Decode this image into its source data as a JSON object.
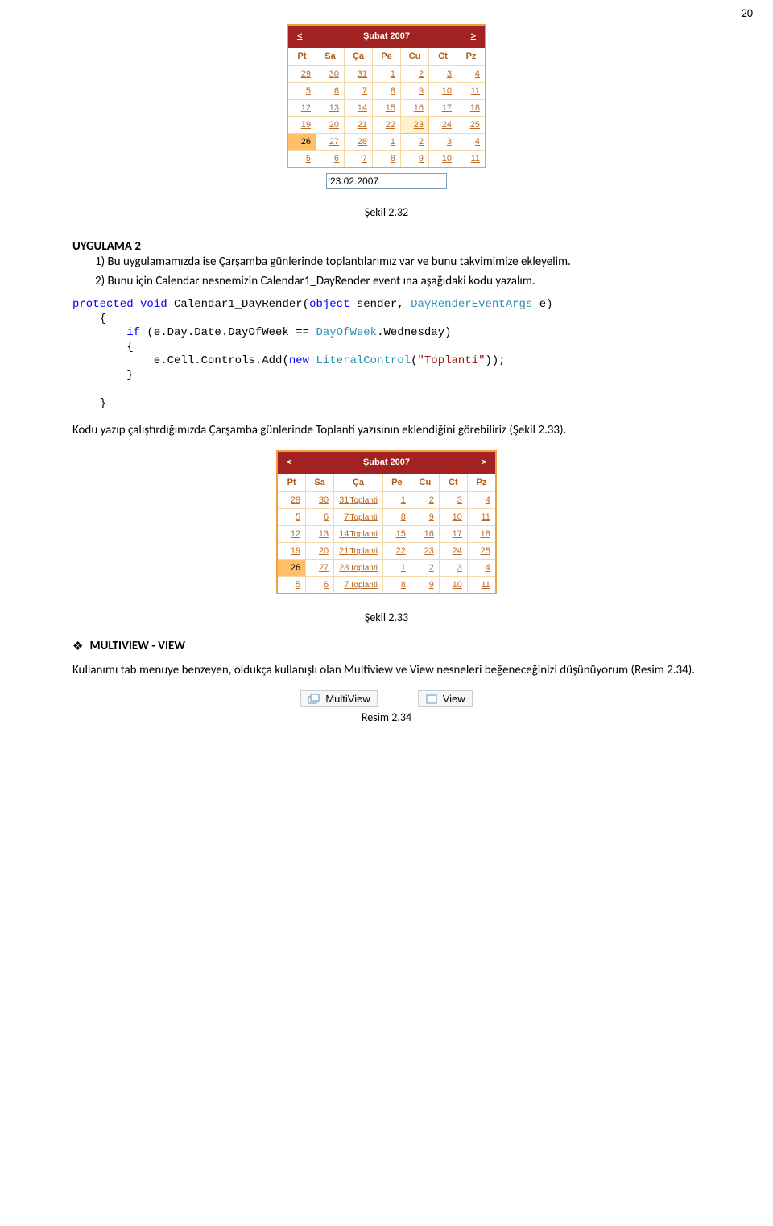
{
  "page_number": "20",
  "calendar1": {
    "title": "Şubat 2007",
    "prev": "<",
    "next": ">",
    "weekdays": [
      "Pt",
      "Sa",
      "Ça",
      "Pe",
      "Cu",
      "Ct",
      "Pz"
    ],
    "rows": [
      [
        {
          "d": "29"
        },
        {
          "d": "30"
        },
        {
          "d": "31"
        },
        {
          "d": "1"
        },
        {
          "d": "2"
        },
        {
          "d": "3"
        },
        {
          "d": "4"
        }
      ],
      [
        {
          "d": "5"
        },
        {
          "d": "6"
        },
        {
          "d": "7"
        },
        {
          "d": "8"
        },
        {
          "d": "9"
        },
        {
          "d": "10"
        },
        {
          "d": "11"
        }
      ],
      [
        {
          "d": "12"
        },
        {
          "d": "13"
        },
        {
          "d": "14"
        },
        {
          "d": "15"
        },
        {
          "d": "16"
        },
        {
          "d": "17"
        },
        {
          "d": "18"
        }
      ],
      [
        {
          "d": "19"
        },
        {
          "d": "20"
        },
        {
          "d": "21"
        },
        {
          "d": "22"
        },
        {
          "d": "23",
          "cls": "sel"
        },
        {
          "d": "24"
        },
        {
          "d": "25"
        }
      ],
      [
        {
          "d": "26",
          "cls": "today"
        },
        {
          "d": "27"
        },
        {
          "d": "28"
        },
        {
          "d": "1"
        },
        {
          "d": "2"
        },
        {
          "d": "3"
        },
        {
          "d": "4"
        }
      ],
      [
        {
          "d": "5"
        },
        {
          "d": "6"
        },
        {
          "d": "7"
        },
        {
          "d": "8"
        },
        {
          "d": "9"
        },
        {
          "d": "10"
        },
        {
          "d": "11"
        }
      ]
    ]
  },
  "datebox_value": "23.02.2007",
  "caption_1": "Şekil 2.32",
  "heading_uyg": "UYGULAMA 2",
  "list1_1": "1) Bu uygulamamızda ise Çarşamba günlerinde toplantılarımız var ve bunu takvimimize ekleyelim.",
  "list1_2": "2) Bunu için Calendar nesnemizin Calendar1_DayRender event ına aşağıdaki kodu yazalım.",
  "code_lines": [
    {
      "t": "protected ",
      "c": "kw-blue"
    },
    {
      "t": "void ",
      "c": "kw-blue"
    },
    {
      "t": "Calendar1_DayRender(",
      "c": ""
    },
    {
      "t": "object ",
      "c": "kw-blue"
    },
    {
      "t": "sender, ",
      "c": ""
    },
    {
      "t": "DayRenderEventArgs ",
      "c": "kw-teal"
    },
    {
      "t": "e)\n",
      "c": ""
    },
    {
      "t": "    {\n",
      "c": ""
    },
    {
      "t": "        if ",
      "c": "kw-blue"
    },
    {
      "t": "(e.Day.Date.DayOfWeek == ",
      "c": ""
    },
    {
      "t": "DayOfWeek",
      ",c": "kw-teal",
      "c": "kw-teal"
    },
    {
      "t": ".Wednesday)\n",
      "c": ""
    },
    {
      "t": "        {\n",
      "c": ""
    },
    {
      "t": "            e.Cell.Controls.Add(",
      "c": ""
    },
    {
      "t": "new ",
      "c": "kw-blue"
    },
    {
      "t": "LiteralControl",
      "c": "kw-teal"
    },
    {
      "t": "(",
      "c": ""
    },
    {
      "t": "\"Toplanti\"",
      "c": "kw-str"
    },
    {
      "t": "));\n",
      "c": ""
    },
    {
      "t": "        }\n",
      "c": ""
    },
    {
      "t": "\n",
      "c": ""
    },
    {
      "t": "    }\n",
      "c": ""
    }
  ],
  "para_result": "Kodu yazıp çalıştırdığımızda Çarşamba günlerinde Toplanti yazısının eklendiğini görebiliriz (Şekil 2.33).",
  "calendar2": {
    "title": "Şubat 2007",
    "prev": "<",
    "next": ">",
    "weekdays": [
      "Pt",
      "Sa",
      "Ça",
      "Pe",
      "Cu",
      "Ct",
      "Pz"
    ],
    "rows": [
      [
        {
          "d": "29"
        },
        {
          "d": "30"
        },
        {
          "d": "31",
          "t": "Toplanti"
        },
        {
          "d": "1"
        },
        {
          "d": "2"
        },
        {
          "d": "3"
        },
        {
          "d": "4"
        }
      ],
      [
        {
          "d": "5"
        },
        {
          "d": "6"
        },
        {
          "d": "7",
          "t": "Toplanti"
        },
        {
          "d": "8"
        },
        {
          "d": "9"
        },
        {
          "d": "10"
        },
        {
          "d": "11"
        }
      ],
      [
        {
          "d": "12"
        },
        {
          "d": "13"
        },
        {
          "d": "14",
          "t": "Toplanti"
        },
        {
          "d": "15"
        },
        {
          "d": "16"
        },
        {
          "d": "17"
        },
        {
          "d": "18"
        }
      ],
      [
        {
          "d": "19"
        },
        {
          "d": "20"
        },
        {
          "d": "21",
          "t": "Toplanti"
        },
        {
          "d": "22"
        },
        {
          "d": "23"
        },
        {
          "d": "24"
        },
        {
          "d": "25"
        }
      ],
      [
        {
          "d": "26",
          "cls": "today"
        },
        {
          "d": "27"
        },
        {
          "d": "28",
          "t": "Toplanti"
        },
        {
          "d": "1"
        },
        {
          "d": "2"
        },
        {
          "d": "3"
        },
        {
          "d": "4"
        }
      ],
      [
        {
          "d": "5"
        },
        {
          "d": "6"
        },
        {
          "d": "7",
          "t": "Toplanti"
        },
        {
          "d": "8"
        },
        {
          "d": "9"
        },
        {
          "d": "10"
        },
        {
          "d": "11"
        }
      ]
    ]
  },
  "caption_2": "Şekil 2.33",
  "mv_title": "MULTIVIEW - VIEW",
  "mv_para": "Kullanımı tab menuye benzeyen, oldukça kullanışlı olan Multiview ve View nesneleri beğeneceğinizi düşünüyorum (Resim 2.34).",
  "toolbox": {
    "multiview": "MultiView",
    "view": "View"
  },
  "caption_3": "Resim 2.34"
}
